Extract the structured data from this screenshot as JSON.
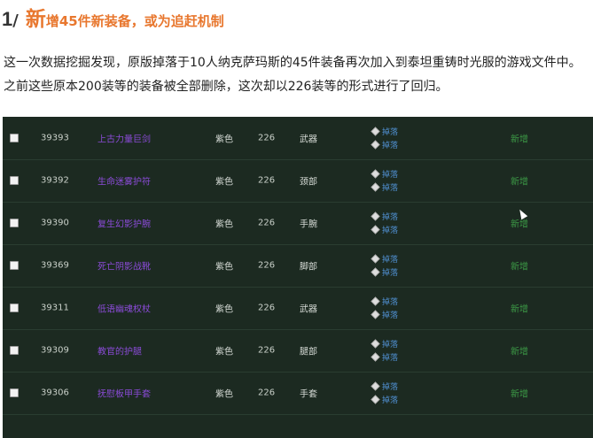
{
  "heading": {
    "number": "1",
    "slash": "/",
    "first_char": "新",
    "rest": "增45件新装备，或为追赶机制"
  },
  "paragraph": "这一次数据挖掘发现，原版掉落于10人纳克萨玛斯的45件装备再次加入到泰坦重铸时光服的游戏文件中。之前这些原本200装等的装备被全部删除，这次却以226装等的形式进行了回归。",
  "table": {
    "drop_label": "掉落",
    "rows": [
      {
        "id": "39393",
        "name": "上古力量巨剑",
        "quality": "紫色",
        "ilvl": "226",
        "slot": "武器",
        "status": "新增"
      },
      {
        "id": "39392",
        "name": "生命迷雾护符",
        "quality": "紫色",
        "ilvl": "226",
        "slot": "颈部",
        "status": "新增"
      },
      {
        "id": "39390",
        "name": "复生幻影护腕",
        "quality": "紫色",
        "ilvl": "226",
        "slot": "手腕",
        "status": "新增"
      },
      {
        "id": "39369",
        "name": "死亡阴影战靴",
        "quality": "紫色",
        "ilvl": "226",
        "slot": "脚部",
        "status": "新增"
      },
      {
        "id": "39311",
        "name": "低语幽魂权杖",
        "quality": "紫色",
        "ilvl": "226",
        "slot": "武器",
        "status": "新增"
      },
      {
        "id": "39309",
        "name": "教官的护腿",
        "quality": "紫色",
        "ilvl": "226",
        "slot": "腿部",
        "status": "新增"
      },
      {
        "id": "39306",
        "name": "抚慰板甲手套",
        "quality": "紫色",
        "ilvl": "226",
        "slot": "手套",
        "status": "新增"
      }
    ]
  },
  "colors": {
    "accent": "#e8772e",
    "panel_bg": "#1c2a21",
    "item_name": "#8a4bd6",
    "status": "#3c9a46",
    "drop_link": "#4f8fd0"
  }
}
